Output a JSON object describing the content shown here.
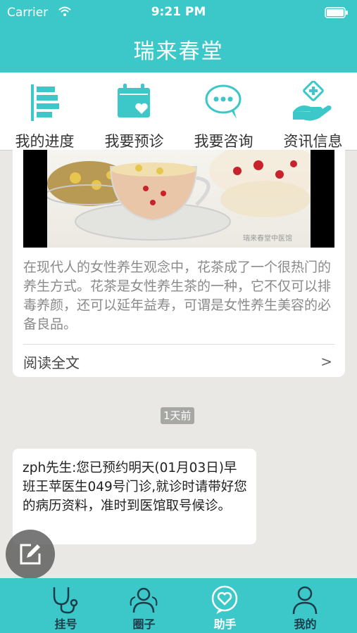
{
  "status_bar": {
    "carrier": "Carrier",
    "time": "9:21 PM"
  },
  "nav": {
    "title": "瑞来春堂"
  },
  "quick_menu": [
    {
      "label": "我的进度",
      "icon": "progress-bars-icon"
    },
    {
      "label": "我要预诊",
      "icon": "calendar-heart-icon"
    },
    {
      "label": "我要咨询",
      "icon": "chat-bubble-icon"
    },
    {
      "label": "资讯信息",
      "icon": "hand-plus-icon"
    }
  ],
  "article": {
    "photo_watermark": "瑞来春堂中医馆",
    "text": "在现代人的女性养生观念中，花茶成了一个很热门的养生方式。花茶是女性养生茶的一种，它不仅可以排毒养颜，还可以延年益寿，可谓是女性养生美容的必备良品。",
    "read_more": "阅读全文",
    "chevron": ">"
  },
  "time_badge": "1天前",
  "message": {
    "text": "zph先生:您已预约明天(01月03日)早班王苹医生049号门诊,就诊时请带好您的病历资料，准时到医馆取号候诊。"
  },
  "tab_bar": [
    {
      "label": "挂号",
      "icon": "stethoscope-icon"
    },
    {
      "label": "圈子",
      "icon": "community-icon"
    },
    {
      "label": "助手",
      "icon": "heart-chat-icon"
    },
    {
      "label": "我的",
      "icon": "person-icon"
    }
  ],
  "colors": {
    "accent": "#3cc8c8",
    "background": "#e9e8e4"
  }
}
